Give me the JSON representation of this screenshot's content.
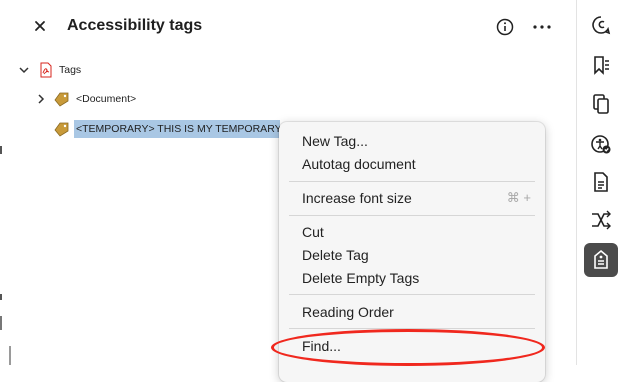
{
  "panel": {
    "title": "Accessibility tags",
    "close_icon": "close-icon",
    "info_icon": "info-icon",
    "more_icon": "more-icon"
  },
  "tree": {
    "root": {
      "label": "Tags",
      "icon": "pdf-file-icon",
      "expanded": true
    },
    "items": [
      {
        "label": "<Document>",
        "icon": "tag-icon",
        "expandable": true,
        "selected": false
      },
      {
        "label": "<TEMPORARY> THIS IS MY TEMPORARY TAG",
        "icon": "tag-icon",
        "expandable": false,
        "selected": true
      }
    ]
  },
  "context_menu": {
    "groups": [
      [
        {
          "label": "New Tag..."
        },
        {
          "label": "Autotag document"
        }
      ],
      [
        {
          "label": "Increase font size",
          "shortcut": "⌘ +"
        }
      ],
      [
        {
          "label": "Cut"
        },
        {
          "label": "Delete Tag"
        },
        {
          "label": "Delete Empty Tags"
        }
      ],
      [
        {
          "label": "Reading Order"
        }
      ],
      [
        {
          "label": "Find..."
        }
      ]
    ],
    "highlighted_item": "Find..."
  },
  "right_toolbar": {
    "icons": [
      "comment-icon",
      "bookmark-list-icon",
      "copy-pages-icon",
      "accessibility-check-icon",
      "document-properties-icon",
      "compare-icon",
      "accessibility-tags-icon"
    ],
    "active": "accessibility-tags-icon"
  },
  "colors": {
    "selection": "#a9c7e4",
    "highlight_oval": "#f0281e",
    "menu_bg": "#f6f6f6",
    "active_tool_bg": "#4b4b4b",
    "pdf_red": "#d7261e",
    "tag_gold": "#c89a3a"
  }
}
